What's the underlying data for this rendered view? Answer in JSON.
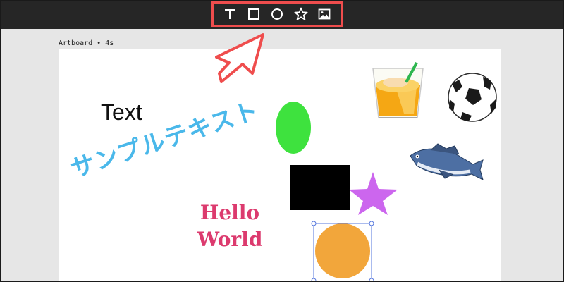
{
  "toolbar": {
    "tools": [
      {
        "name": "text-tool",
        "icon": "text-icon"
      },
      {
        "name": "rectangle-tool",
        "icon": "rectangle-icon"
      },
      {
        "name": "ellipse-tool",
        "icon": "circle-icon"
      },
      {
        "name": "star-tool",
        "icon": "star-icon"
      },
      {
        "name": "image-tool",
        "icon": "image-icon"
      }
    ],
    "highlight_color": "#ef4d4d"
  },
  "artboard": {
    "label": "Artboard • 4s"
  },
  "canvas": {
    "text_element": "Text",
    "japanese_text": "サンプルテキスト",
    "hello_line1": "Hello",
    "hello_line2": "World",
    "colors": {
      "ellipse": "#3ee23e",
      "rectangle": "#000000",
      "star": "#cc66ee",
      "circle": "#f2a63b",
      "japanese_text": "#4ab8ea",
      "hello_world": "#dc3a6e",
      "selection": "#5577dd",
      "pointer_arrow": "#ef4d4d"
    },
    "images": [
      "orange-juice-image",
      "soccer-ball-image",
      "fish-image"
    ]
  }
}
